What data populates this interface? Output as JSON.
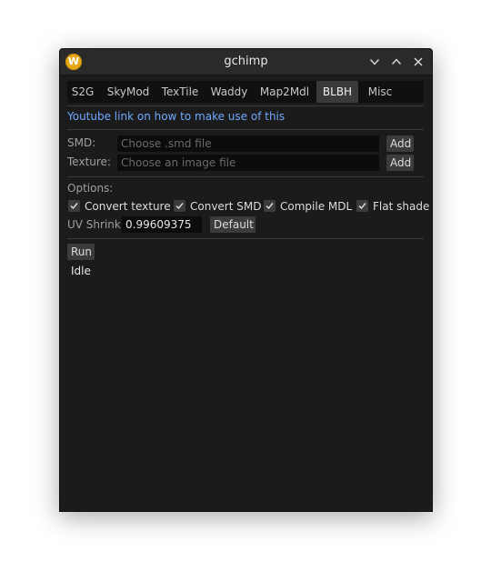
{
  "window": {
    "title": "gchimp",
    "icon": "W"
  },
  "tabs": [
    {
      "label": "S2G",
      "active": false
    },
    {
      "label": "SkyMod",
      "active": false
    },
    {
      "label": "TexTile",
      "active": false
    },
    {
      "label": "Waddy",
      "active": false
    },
    {
      "label": "Map2Mdl",
      "active": false
    },
    {
      "label": "BLBH",
      "active": true
    },
    {
      "label": "Misc",
      "active": false
    }
  ],
  "link_text": "Youtube link on how to make use of this",
  "smd": {
    "label": "SMD:",
    "placeholder": "Choose .smd file",
    "add_label": "Add"
  },
  "texture": {
    "label": "Texture:",
    "placeholder": "Choose an image file",
    "add_label": "Add"
  },
  "options": {
    "label": "Options:",
    "checkboxes": [
      {
        "label": "Convert texture",
        "checked": true
      },
      {
        "label": "Convert SMD",
        "checked": true
      },
      {
        "label": "Compile MDL",
        "checked": true
      },
      {
        "label": "Flat shade",
        "checked": true
      }
    ]
  },
  "uv_shrink": {
    "label": "UV Shrink",
    "value": "0.99609375",
    "default_label": "Default"
  },
  "run_label": "Run",
  "status": "Idle",
  "colors": {
    "window_bg": "#1b1b1b",
    "titlebar_bg": "#2a2a2a",
    "link": "#6fa9ff",
    "app_icon": "#e6a817"
  }
}
